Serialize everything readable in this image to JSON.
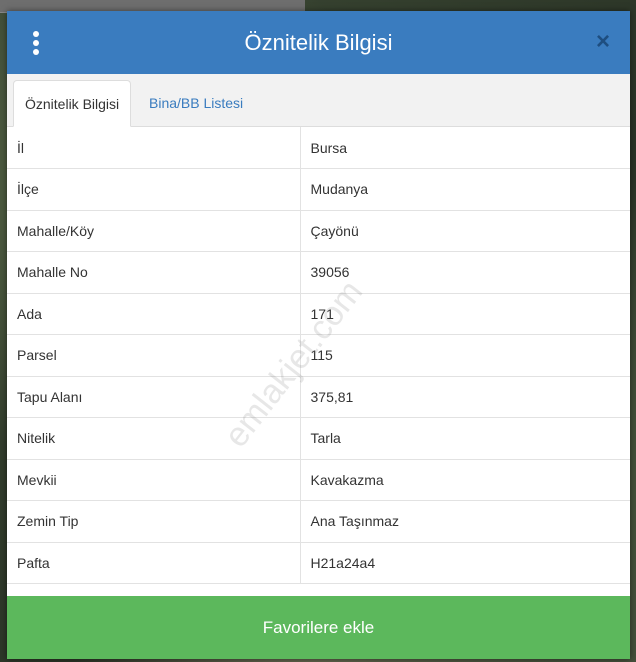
{
  "header": {
    "title": "Öznitelik Bilgisi",
    "close_glyph": "×"
  },
  "tabs": [
    {
      "label": "Öznitelik Bilgisi",
      "active": true
    },
    {
      "label": "Bina/BB Listesi",
      "active": false
    }
  ],
  "attributes": [
    {
      "key": "İl",
      "value": "Bursa"
    },
    {
      "key": "İlçe",
      "value": "Mudanya"
    },
    {
      "key": "Mahalle/Köy",
      "value": "Çayönü"
    },
    {
      "key": "Mahalle No",
      "value": "39056"
    },
    {
      "key": "Ada",
      "value": "171"
    },
    {
      "key": "Parsel",
      "value": "115"
    },
    {
      "key": "Tapu Alanı",
      "value": "375,81"
    },
    {
      "key": "Nitelik",
      "value": "Tarla"
    },
    {
      "key": "Mevkii",
      "value": "Kavakazma"
    },
    {
      "key": "Zemin Tip",
      "value": "Ana Taşınmaz"
    },
    {
      "key": "Pafta",
      "value": "H21a24a4"
    }
  ],
  "watermark": "emlakjet.com",
  "footer": {
    "favorite_label": "Favorilere ekle"
  },
  "colors": {
    "header": "#3a7cbf",
    "button": "#5cb85c",
    "link": "#3a7cbf"
  }
}
